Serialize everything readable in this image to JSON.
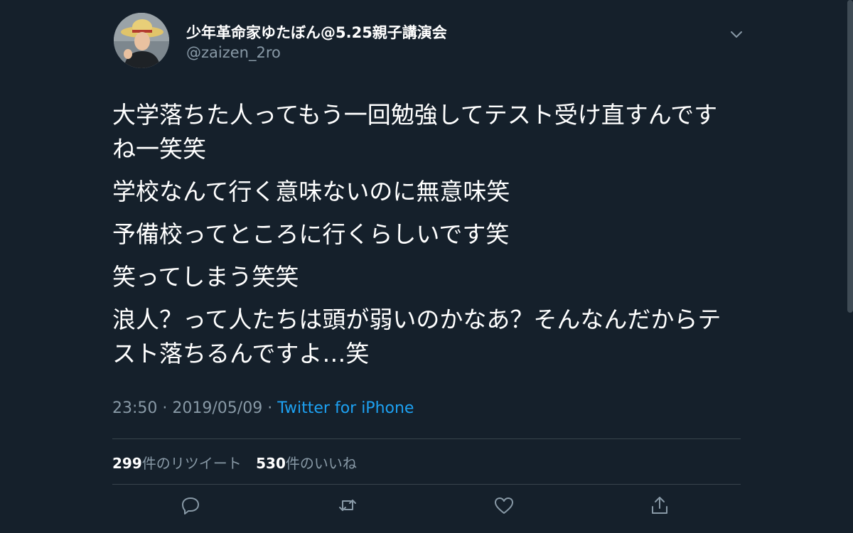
{
  "author": {
    "display_name": "少年革命家ゆたぼん@5.25親子講演会",
    "handle": "@zaizen_2ro"
  },
  "tweet": {
    "paragraphs": [
      "大学落ちた人ってもう一回勉強してテスト受け直すんですね一笑笑",
      "学校なんて行く意味ないのに無意味笑",
      "予備校ってところに行くらしいです笑",
      "笑ってしまう笑笑",
      "浪人？って人たちは頭が弱いのかなあ？そんなんだからテスト落ちるんですよ…笑"
    ]
  },
  "meta": {
    "time": "23:50",
    "separator": "·",
    "date": "2019/05/09",
    "source": "Twitter for iPhone"
  },
  "stats": {
    "retweets_count": "299",
    "retweets_label": "件のリツイート",
    "likes_count": "530",
    "likes_label": "件のいいね"
  },
  "icons": {
    "menu": "chevron-down-icon",
    "reply": "reply-icon",
    "retweet": "retweet-icon",
    "like": "heart-icon",
    "share": "share-icon"
  },
  "colors": {
    "background": "#15202b",
    "text": "#ffffff",
    "secondary": "#8899a6",
    "link": "#1da1f2",
    "divider": "#38444d"
  }
}
